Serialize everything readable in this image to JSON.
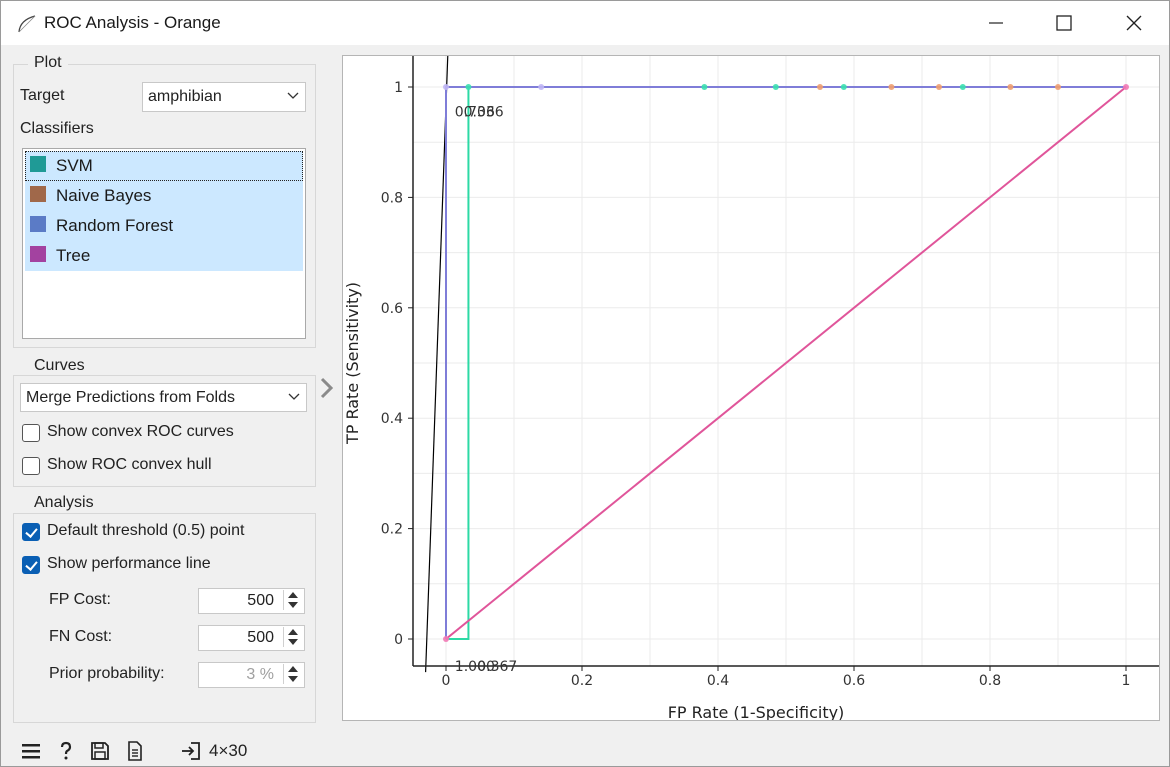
{
  "window": {
    "title": "ROC Analysis - Orange"
  },
  "plot_group": {
    "legend": "Plot",
    "target_label": "Target",
    "target_value": "amphibian",
    "classifiers_label": "Classifiers",
    "classifiers": [
      {
        "name": "SVM",
        "color": "#1f9a96"
      },
      {
        "name": "Naive Bayes",
        "color": "#a0684a"
      },
      {
        "name": "Random Forest",
        "color": "#5b7bc6"
      },
      {
        "name": "Tree",
        "color": "#a342a0"
      }
    ]
  },
  "curves_group": {
    "legend": "Curves",
    "mode_value": "Merge Predictions from Folds",
    "show_convex_curves": "Show convex ROC curves",
    "show_convex_hull": "Show ROC convex hull"
  },
  "analysis_group": {
    "legend": "Analysis",
    "default_threshold": "Default threshold (0.5) point",
    "show_performance_line": "Show performance line",
    "fp_cost_label": "FP Cost:",
    "fp_cost_value": "500",
    "fn_cost_label": "FN Cost:",
    "fn_cost_value": "500",
    "prior_label": "Prior probability:",
    "prior_value": "3 %"
  },
  "chart_data": {
    "type": "line",
    "xlabel": "FP Rate (1-Specificity)",
    "ylabel": "TP Rate (Sensitivity)",
    "xlim": [
      -0.05,
      1.02
    ],
    "ylim": [
      -0.05,
      1.05
    ],
    "xticks": [
      0,
      0.2,
      0.4,
      0.6,
      0.8,
      1
    ],
    "yticks": [
      0,
      0.2,
      0.4,
      0.6,
      0.8,
      1
    ],
    "xtick_labels": [
      "0",
      "0.2",
      "0.4",
      "0.6",
      "0.8",
      "1"
    ],
    "ytick_labels": [
      "0",
      "0.2",
      "0.4",
      "0.6",
      "0.8",
      "1"
    ],
    "grid": true,
    "series": [
      {
        "color": "#1f9a96",
        "x": [
          0,
          0.033,
          0.033,
          1
        ],
        "y": [
          0,
          0,
          1,
          1
        ],
        "points_x": [
          0.033,
          0.38,
          0.485,
          0.585,
          0.76
        ],
        "points_y": [
          1,
          1,
          1,
          1,
          1
        ]
      },
      {
        "color": "#a0684a",
        "x": [
          0,
          0,
          1
        ],
        "y": [
          0,
          1,
          1
        ],
        "points_x": [
          0.55,
          0.655,
          0.725,
          0.83,
          0.9
        ],
        "points_y": [
          1,
          1,
          1,
          1,
          1
        ]
      },
      {
        "color": "#5b7bc6",
        "x": [
          0,
          0,
          1
        ],
        "y": [
          0,
          1,
          1
        ],
        "points_x": [
          0,
          0.14
        ],
        "points_y": [
          1,
          1
        ]
      },
      {
        "color": "#e0559a",
        "x": [
          0,
          1
        ],
        "y": [
          0,
          1
        ],
        "points_x": [
          0,
          1
        ],
        "points_y": [
          0,
          1
        ]
      }
    ],
    "annotations": [
      {
        "text": "0.706",
        "x": 0.01,
        "y": 0.985,
        "color": "#333333"
      },
      {
        "text": "0.336",
        "x": 0.023,
        "y": 0.985,
        "color": "#333333"
      },
      {
        "text": "1.000",
        "x": 0.01,
        "y": -0.02,
        "color": "#333333"
      },
      {
        "text": "0.367",
        "x": 0.043,
        "y": -0.02,
        "color": "#333333"
      }
    ],
    "performance_line": {
      "x": [
        -0.03,
        0.003
      ],
      "y": [
        -0.06,
        1.07
      ],
      "color": "#000000"
    }
  },
  "status": {
    "data_size": "4×30"
  }
}
